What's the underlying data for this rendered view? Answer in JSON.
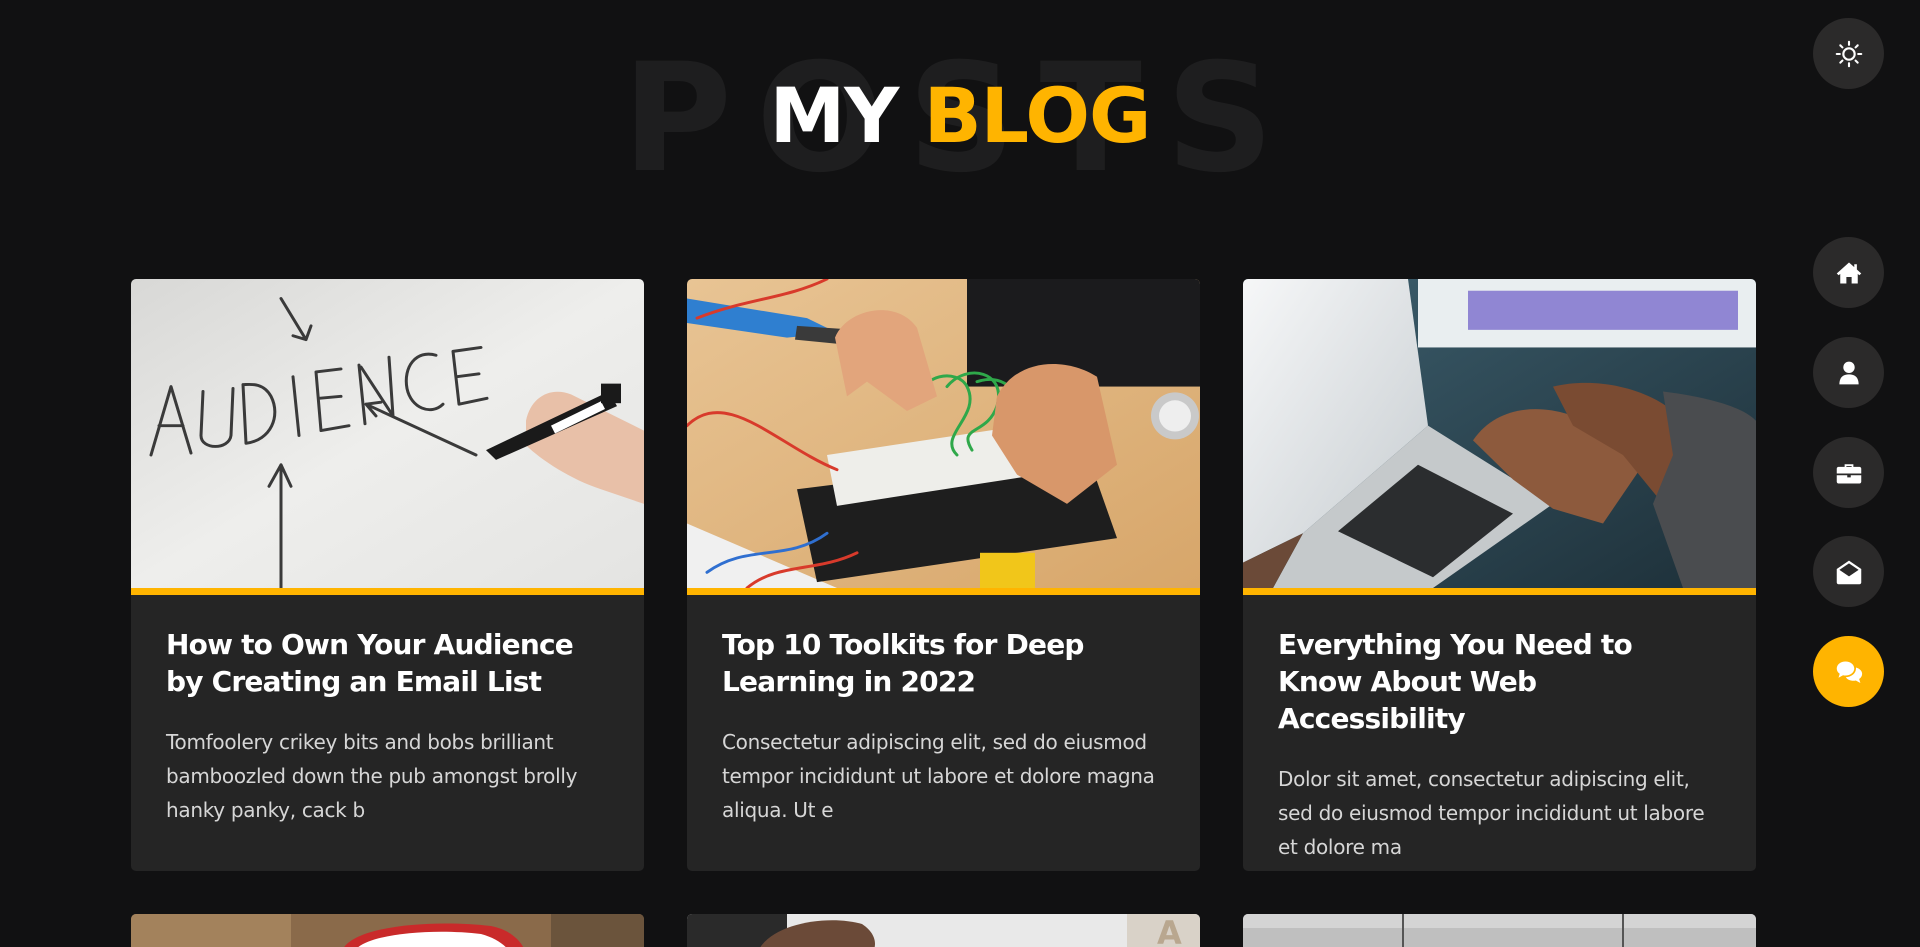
{
  "header": {
    "background_word": "POSTS",
    "title_part1": "MY",
    "title_part2": "BLOG"
  },
  "colors": {
    "accent": "#ffb400",
    "background": "#111112",
    "card": "#252525",
    "nav_button": "#2b2a2a"
  },
  "nav": {
    "theme_toggle_icon": "sun-icon",
    "items": [
      {
        "icon": "home-icon"
      },
      {
        "icon": "user-icon"
      },
      {
        "icon": "briefcase-icon"
      },
      {
        "icon": "envelope-open-icon"
      },
      {
        "icon": "comments-icon",
        "active": true
      }
    ]
  },
  "posts": [
    {
      "title": "How to Own Your Audience by Creating an Email List",
      "excerpt": "Tomfoolery crikey bits and bobs brilliant bamboozled down the pub amongst brolly hanky panky, cack b"
    },
    {
      "title": "Top 10 Toolkits for Deep Learning in 2022",
      "excerpt": "Consectetur adipiscing elit, sed do eiusmod tempor incididunt ut labore et dolore magna aliqua. Ut e"
    },
    {
      "title": "Everything You Need to Know About Web Accessibility",
      "excerpt": "Dolor sit amet, consectetur adipiscing elit, sed do eiusmod tempor incididunt ut labore et dolore ma"
    }
  ]
}
